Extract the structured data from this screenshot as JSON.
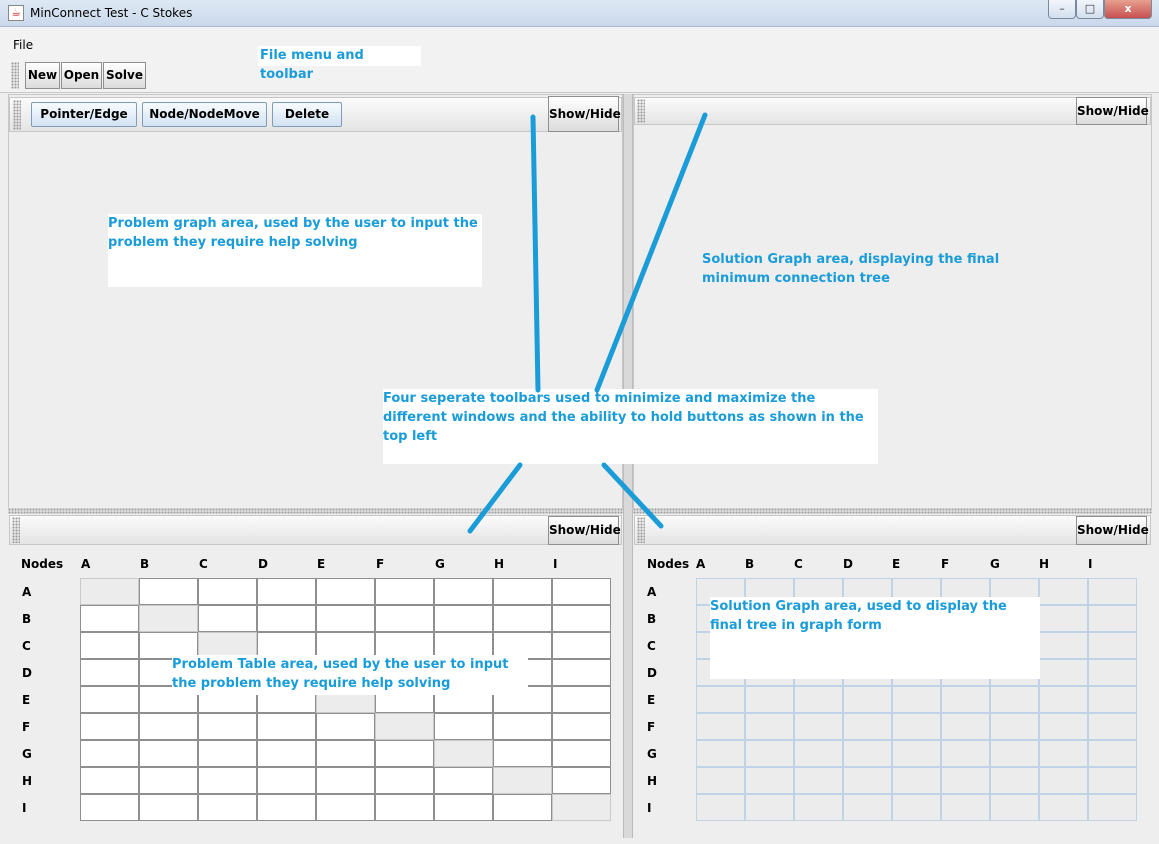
{
  "window": {
    "title": "MinConnect Test - C Stokes",
    "controls": [
      "–",
      "□",
      "x"
    ]
  },
  "menu": {
    "file": "File"
  },
  "toolbar": {
    "new": "New",
    "open": "Open",
    "solve": "Solve"
  },
  "problem_graph": {
    "buttons": [
      "Pointer/Edge",
      "Node/NodeMove",
      "Delete"
    ],
    "show_hide": "Show/Hide"
  },
  "solution_graph": {
    "show_hide": "Show/Hide"
  },
  "problem_table": {
    "show_hide": "Show/Hide",
    "corner": "Nodes"
  },
  "solution_table": {
    "show_hide": "Show/Hide",
    "corner": "Nodes"
  },
  "nodes": [
    "A",
    "B",
    "C",
    "D",
    "E",
    "F",
    "G",
    "H",
    "I"
  ],
  "annotations": {
    "menu": "File menu and toolbar",
    "problem_graph": "Problem graph area, used by the user to input the problem they require help solving",
    "solution_graph": "Solution Graph area, displaying the final minimum connection tree",
    "toolbars": "Four seperate toolbars used to minimize and maximize the different windows and the ability to hold buttons as shown in the top left",
    "problem_table": "Problem Table area, used by the user to input the problem they require help solving",
    "solution_table": "Solution Graph area, used to display the final tree in graph form"
  },
  "colors": {
    "annotation_text": "#1a9cd8",
    "arrow": "#1a9cd8"
  }
}
